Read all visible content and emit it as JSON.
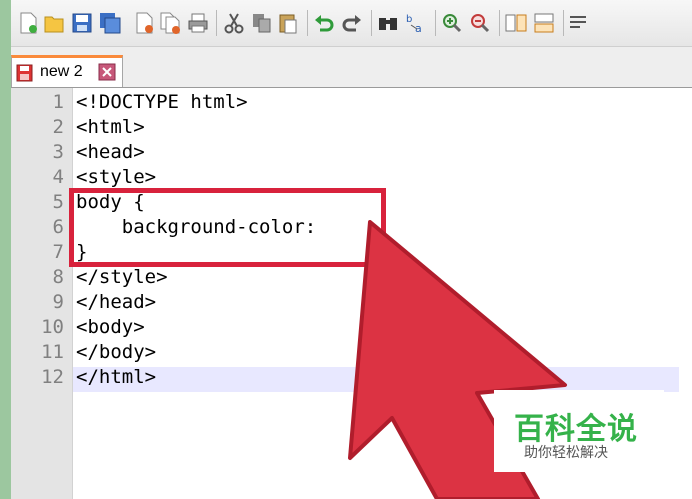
{
  "toolbar": {
    "buttons": [
      "new-file-icon",
      "open-file-icon",
      "save-icon",
      "save-all-icon",
      "close-icon",
      "close-all-icon",
      "print-icon",
      "cut-icon",
      "copy-icon",
      "paste-icon",
      "undo-icon",
      "redo-icon",
      "find-icon",
      "replace-icon",
      "zoom-in-icon",
      "zoom-out-icon",
      "sync-vertical-icon",
      "sync-horizontal-icon",
      "word-wrap-icon"
    ]
  },
  "tab": {
    "label": "new 2"
  },
  "editor": {
    "line_numbers": [
      "1",
      "2",
      "3",
      "4",
      "5",
      "6",
      "7",
      "8",
      "9",
      "10",
      "11",
      "12"
    ],
    "lines": [
      "<!DOCTYPE html>",
      "<html>",
      "<head>",
      "<style>",
      "body {",
      "    background-color:",
      "}",
      "</style>",
      "</head>",
      "<body>",
      "</body>",
      "</html>"
    ],
    "current_line": 12
  },
  "annotation": {
    "box_color": "#d8223c",
    "arrow_color": "#dc3343"
  },
  "watermark": {
    "title": "百科全说",
    "subtitle": "助你轻松解决"
  },
  "colors": {
    "tab_accent": "#fa8a3b",
    "gutter": "#e4e4e4",
    "current_line": "#e8e8ff",
    "page_bg": "#9cc79f"
  }
}
